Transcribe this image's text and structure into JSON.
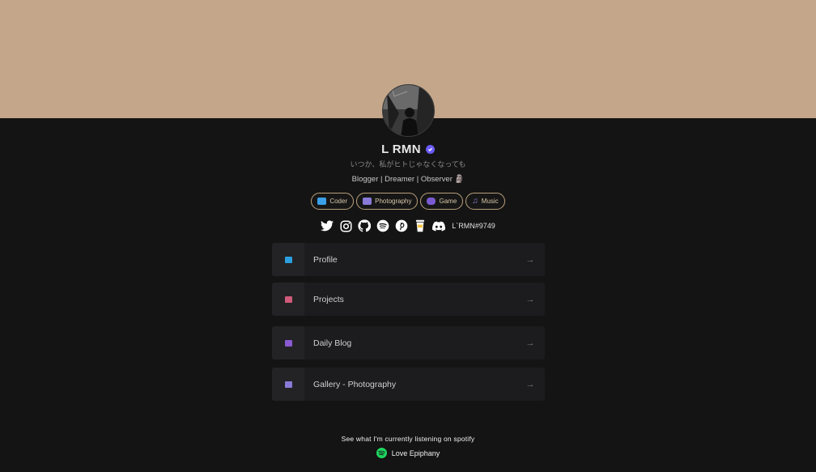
{
  "profile": {
    "name": "L RMN",
    "tagline": "いつか、私がヒトじゃなくなっても",
    "bio": "Blogger | Dreamer | Observer 🗿"
  },
  "chips": [
    {
      "label": "Coder",
      "icon": "laptop-icon",
      "color": "#3aa0e8"
    },
    {
      "label": "Photography",
      "icon": "camera-icon",
      "color": "#8a7ad8"
    },
    {
      "label": "Game",
      "icon": "gamepad-icon",
      "color": "#7a5ad0"
    },
    {
      "label": "Music",
      "icon": "music-note-icon",
      "color": "#8a7ad8"
    }
  ],
  "socials": {
    "icons": [
      "twitter-icon",
      "instagram-icon",
      "github-icon",
      "spotify-icon",
      "pinterest-icon",
      "buymeacoffee-icon",
      "discord-icon"
    ],
    "discord_tag": "L`RMN#9749"
  },
  "links": [
    {
      "label": "Profile",
      "icon": "card-icon",
      "color": "#2aa0e0"
    },
    {
      "label": "Projects",
      "icon": "box-icon",
      "color": "#d05a7a"
    },
    {
      "label": "Daily Blog",
      "icon": "notebook-icon",
      "color": "#8a5ad0"
    },
    {
      "label": "Gallery - Photography",
      "icon": "camera-icon",
      "color": "#8a7ad8"
    }
  ],
  "spotify": {
    "title": "See what I'm currently listening on spotify",
    "song": "Love Epiphany"
  },
  "colors": {
    "banner": "#c4a68a",
    "background": "#141414",
    "accent": "#6a5cff",
    "chip_border": "#b9a07a",
    "spotify_green": "#1ed760"
  }
}
